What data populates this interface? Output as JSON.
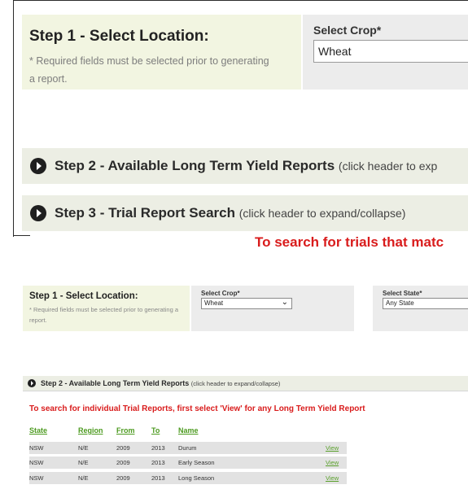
{
  "top": {
    "step1": {
      "title": "Step 1 - Select Location:",
      "note": "* Required fields must be selected prior to generating a report."
    },
    "crop": {
      "label": "Select Crop*",
      "value": "Wheat"
    },
    "step2": {
      "title": "Step 2 - Available Long Term Yield Reports",
      "hint": "(click header to exp"
    },
    "step3": {
      "title": "Step 3 - Trial Report Search",
      "hint": "(click header to expand/collapse)"
    },
    "red_text": "To search for trials that matc"
  },
  "bottom": {
    "step1": {
      "title": "Step 1 - Select Location:",
      "note": "* Required fields must be selected prior to generating a report."
    },
    "crop": {
      "label": "Select Crop*",
      "value": "Wheat"
    },
    "state": {
      "label": "Select State*",
      "value": "Any State"
    },
    "step2": {
      "title": "Step 2 - Available Long Term Yield Reports",
      "hint": "(click header to expand/collapse)"
    },
    "instruction": "To search for individual Trial Reports, first select 'View' for any Long Term Yield Report",
    "columns": {
      "state": "State",
      "region": "Region",
      "from": "From",
      "to": "To",
      "name": "Name"
    },
    "rows": [
      {
        "state": "NSW",
        "region": "N/E",
        "from": "2009",
        "to": "2013",
        "name": "Durum",
        "view": "View"
      },
      {
        "state": "NSW",
        "region": "N/E",
        "from": "2009",
        "to": "2013",
        "name": "Early Season",
        "view": "View"
      },
      {
        "state": "NSW",
        "region": "N/E",
        "from": "2009",
        "to": "2013",
        "name": "Long Season",
        "view": "View"
      }
    ]
  },
  "icons": {
    "expand": "play-circle-icon",
    "dropdown": "chevron-down-icon"
  },
  "colors": {
    "accent_green": "#4c9a1f",
    "alert_red": "#d91c1c",
    "panel_green": "#f2f5e1",
    "panel_grey": "#ececec"
  }
}
